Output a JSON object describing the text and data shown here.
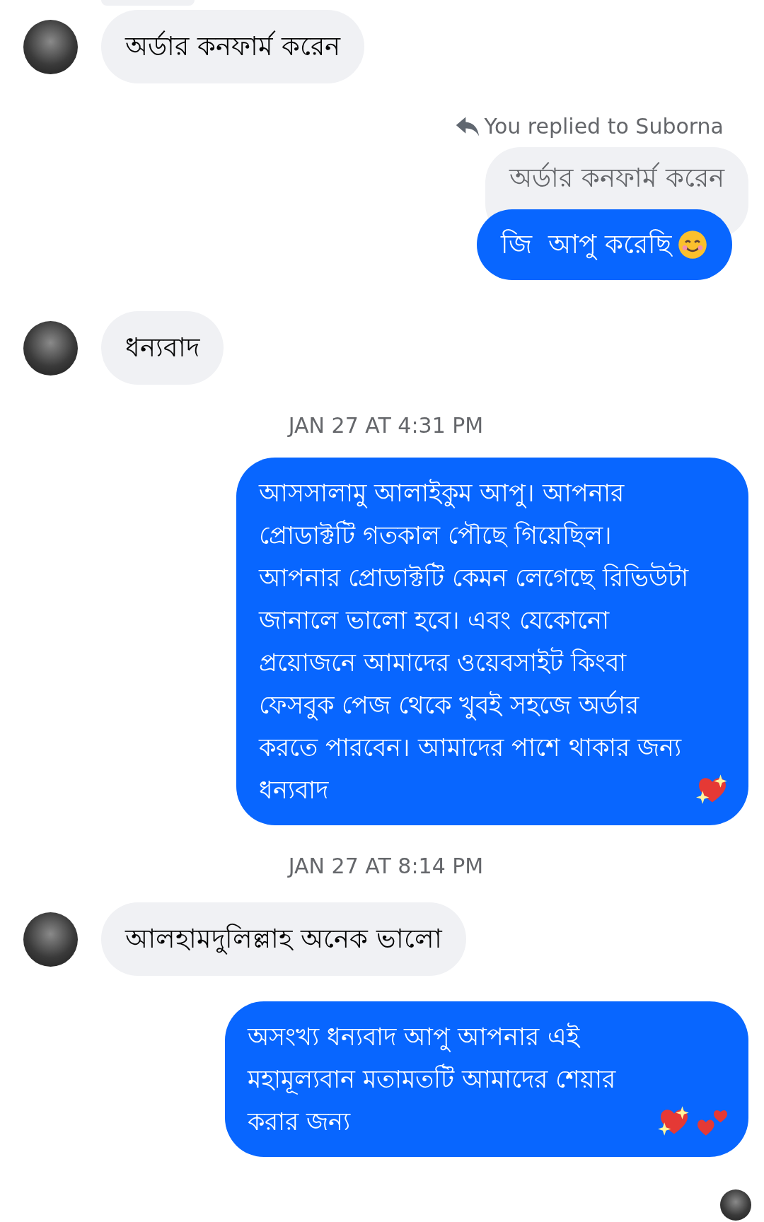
{
  "messages": [
    {
      "kind": "received",
      "text": "অর্ডার কনফার্ম করেন"
    },
    {
      "kind": "reply",
      "label": "You replied to Suborna",
      "quote": "অর্ডার কনফার্ম করেন",
      "text": "জি  আপু করেছি",
      "emojis": [
        {
          "kind": "smiling-face"
        }
      ]
    },
    {
      "kind": "received",
      "text": "ধন্যবাদ"
    },
    {
      "kind": "timestamp",
      "text": "JAN 27 AT 4:31 PM"
    },
    {
      "kind": "sent",
      "text": "আসসালামু আলাইকুম আপু। আপনার প্রোডাক্টটি গতকাল পৌছে গিয়েছিল। আপনার প্রোডাক্টটি কেমন লেগেছে রিভিউটা জানালে ভালো হবে। এবং যেকোনো প্রয়োজনে আমাদের ওয়েবসাইট কিংবা ফেসবুক পেজ থেকে খুবই সহজে অর্ডার করতে পারবেন। আমাদের পাশে থাকার জন্য ধন্যবাদ",
      "emojis": [
        {
          "kind": "sparkling-heart"
        }
      ]
    },
    {
      "kind": "timestamp",
      "text": "JAN 27 AT 8:14 PM"
    },
    {
      "kind": "received",
      "text": "আলহামদুলিল্লাহ অনেক ভালো"
    },
    {
      "kind": "sent",
      "text": "অসংখ্য ধন্যবাদ আপু আপনার এই মহামূল্যবান মতামতটি আমাদের শেয়ার করার জন্য",
      "emojis": [
        {
          "kind": "sparkling-heart"
        },
        {
          "kind": "two-hearts"
        }
      ]
    }
  ]
}
